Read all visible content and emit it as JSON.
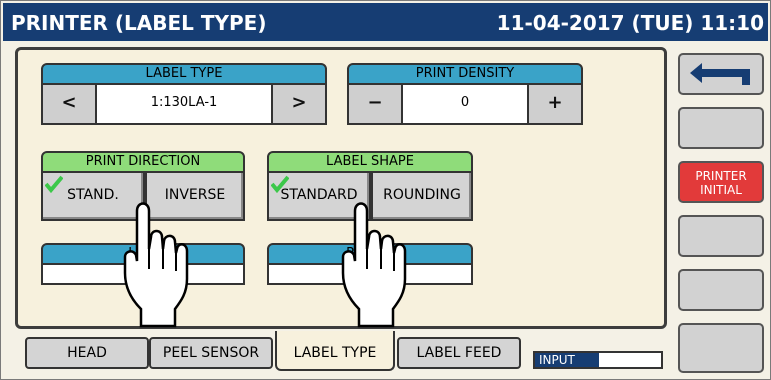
{
  "title": {
    "screen": "PRINTER (LABEL TYPE)",
    "datetime": "11-04-2017 (TUE) 11:10"
  },
  "label_type": {
    "header": "LABEL TYPE",
    "value": "1:130LA-1",
    "prev": "<",
    "next": ">"
  },
  "print_density": {
    "header": "PRINT DENSITY",
    "value": "0",
    "minus": "−",
    "plus": "+"
  },
  "print_direction": {
    "header": "PRINT DIRECTION",
    "options": [
      "STAND.",
      "INVERSE"
    ]
  },
  "label_shape": {
    "header": "LABEL SHAPE",
    "options": [
      "STANDARD",
      "ROUNDING"
    ]
  },
  "label_field": {
    "header": "LA…",
    "value": "1…"
  },
  "rounding_field": {
    "header": "RO…EL",
    "value": "0"
  },
  "tabs": [
    "HEAD",
    "PEEL SENSOR",
    "LABEL TYPE",
    "LABEL FEED"
  ],
  "input_label": "INPUT",
  "side": {
    "printer_initial": "PRINTER\nINITIAL"
  },
  "colors": {
    "title_bg": "#163d73",
    "header_blue": "#3aa3c8",
    "header_green": "#8fdc7a",
    "accent_red": "#e23a3a",
    "check_green": "#3cc84a"
  }
}
